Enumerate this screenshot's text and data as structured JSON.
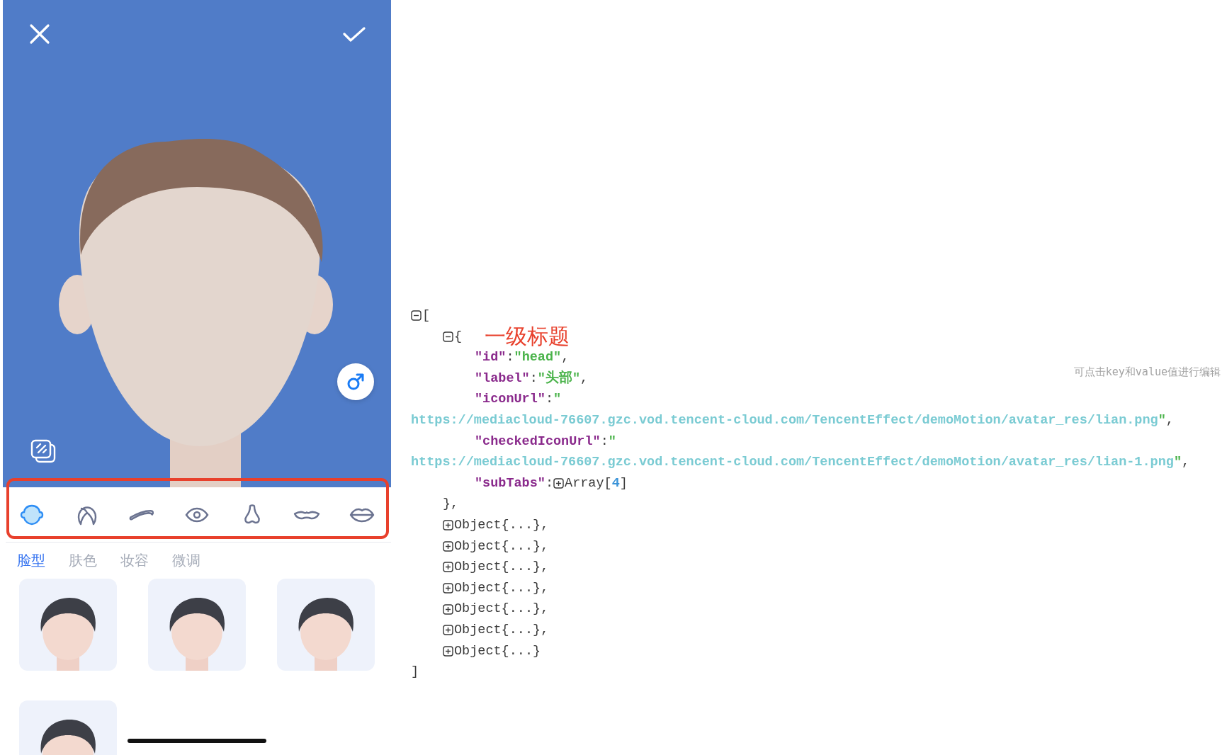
{
  "category_icons": [
    {
      "selected": true
    },
    {
      "selected": false
    },
    {
      "selected": false
    },
    {
      "selected": false
    },
    {
      "selected": false
    },
    {
      "selected": false
    },
    {
      "selected": false
    }
  ],
  "tabs": [
    {
      "label": "脸型",
      "selected": true
    },
    {
      "label": "肤色",
      "selected": false
    },
    {
      "label": "妆容",
      "selected": false
    },
    {
      "label": "微调",
      "selected": false
    }
  ],
  "face_options": [
    {
      "selected": false
    },
    {
      "selected": false
    },
    {
      "selected": false
    },
    {
      "selected": false
    }
  ],
  "json_viewer": {
    "hint": "可点击key和value值进行编辑",
    "tree": {
      "expanded": true,
      "open": "[",
      "close": "]",
      "children": [
        {
          "expanded": true,
          "open": "{",
          "note": "一级标题",
          "close": "},",
          "entries": [
            {
              "kind": "string",
              "key": "\"id\"",
              "colon": ":",
              "value": "\"head\"",
              "comma": ","
            },
            {
              "kind": "string",
              "key": "\"label\"",
              "colon": ":",
              "value": "\"头部\"",
              "comma": ","
            },
            {
              "kind": "url",
              "key": "\"iconUrl\"",
              "colon": ":",
              "quote_open": "\"",
              "url": "https://mediacloud-76607.gzc.vod.tencent-cloud.com/TencentEffect/demoMotion/avatar_res/lian.png",
              "quote_close": "\"",
              "comma": ","
            },
            {
              "kind": "url",
              "key": "\"checkedIconUrl\"",
              "colon": ":",
              "quote_open": "\"",
              "url": "https://mediacloud-76607.gzc.vod.tencent-cloud.com/TencentEffect/demoMotion/avatar_res/lian-1.png",
              "quote_close": "\"",
              "comma": ","
            },
            {
              "kind": "array",
              "key": "\"subTabs\"",
              "colon": ":",
              "expanded": false,
              "summary": "Array[",
              "count": "4",
              "close": "]"
            }
          ]
        },
        {
          "expanded": false,
          "summary": "Object{...}",
          "comma": ","
        },
        {
          "expanded": false,
          "summary": "Object{...}",
          "comma": ","
        },
        {
          "expanded": false,
          "summary": "Object{...}",
          "comma": ","
        },
        {
          "expanded": false,
          "summary": "Object{...}",
          "comma": ","
        },
        {
          "expanded": false,
          "summary": "Object{...}",
          "comma": ","
        },
        {
          "expanded": false,
          "summary": "Object{...}",
          "comma": ","
        },
        {
          "expanded": false,
          "summary": "Object{...}"
        }
      ]
    }
  }
}
